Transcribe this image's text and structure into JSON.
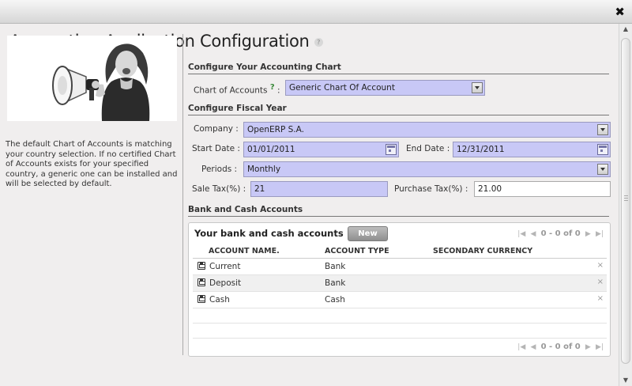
{
  "window": {
    "close_label": "✖"
  },
  "page": {
    "title": "Accounting Application Configuration",
    "help_label": "?"
  },
  "left": {
    "description": "The default Chart of Accounts is matching your country selection. If no certified Chart of Accounts exists for your specified country, a generic one can be installed and will be selected by default."
  },
  "chart_section": {
    "title": "Configure Your Accounting Chart",
    "label": "Chart of Accounts",
    "tip": "?",
    "colon": ":",
    "value": "Generic Chart Of Account"
  },
  "fiscal_section": {
    "title": "Configure Fiscal Year",
    "company_label": "Company :",
    "company_value": "OpenERP S.A.",
    "start_label": "Start Date :",
    "start_value": "01/01/2011",
    "end_label": "End Date :",
    "end_value": "12/31/2011",
    "periods_label": "Periods :",
    "periods_value": "Monthly",
    "sale_tax_label": "Sale Tax(%) :",
    "sale_tax_value": "21",
    "purchase_tax_label": "Purchase Tax(%) :",
    "purchase_tax_value": "21.00"
  },
  "bank_section": {
    "title": "Bank and Cash Accounts",
    "grid_title": "Your bank and cash accounts",
    "new_label": "New",
    "pager_text": "0 - 0 of 0",
    "columns": [
      "ACCOUNT NAME.",
      "ACCOUNT TYPE",
      "SECONDARY CURRENCY"
    ],
    "rows": [
      {
        "name": "Current",
        "type": "Bank",
        "currency": ""
      },
      {
        "name": "Deposit",
        "type": "Bank",
        "currency": ""
      },
      {
        "name": "Cash",
        "type": "Cash",
        "currency": ""
      }
    ],
    "delete_label": "×"
  }
}
